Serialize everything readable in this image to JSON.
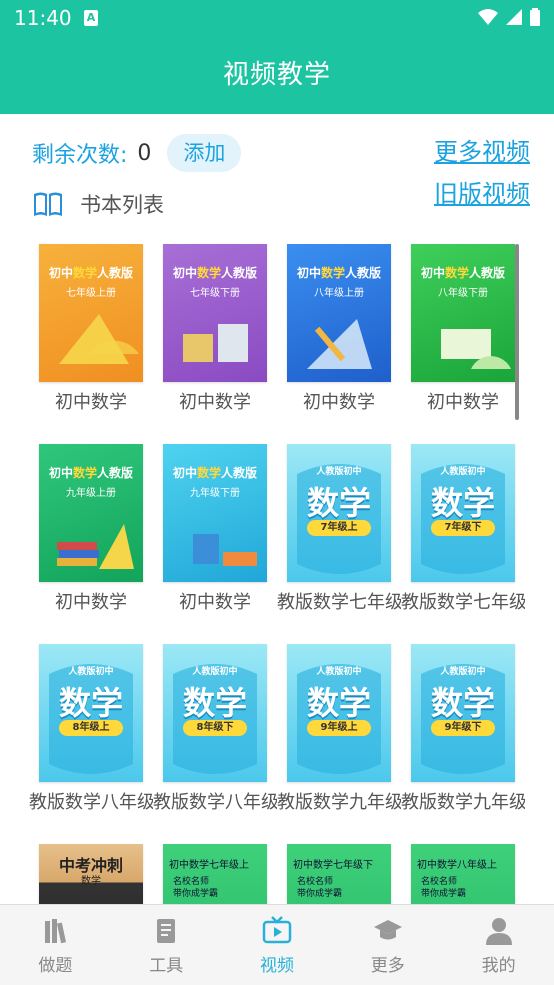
{
  "status_bar": {
    "time": "11:40",
    "notification": "A"
  },
  "header": {
    "title": "视频教学"
  },
  "remain": {
    "label": "剩余次数:",
    "count": "0",
    "add_label": "添加"
  },
  "links": {
    "more_videos": "更多视频",
    "old_videos": "旧版视频"
  },
  "book_list": {
    "title": "书本列表"
  },
  "books": [
    {
      "caption": "初中数学",
      "publisher": "人教版",
      "subject_prefix": "初中",
      "subject": "数学",
      "grade": "七年级上册",
      "style": "orange"
    },
    {
      "caption": "初中数学",
      "publisher": "人教版",
      "subject_prefix": "初中",
      "subject": "数学",
      "grade": "七年级下册",
      "style": "purple"
    },
    {
      "caption": "初中数学",
      "publisher": "人教版",
      "subject_prefix": "初中",
      "subject": "数学",
      "grade": "八年级上册",
      "style": "blue"
    },
    {
      "caption": "初中数学",
      "publisher": "人教版",
      "subject_prefix": "初中",
      "subject": "数学",
      "grade": "八年级下册",
      "style": "green"
    },
    {
      "caption": "初中数学",
      "publisher": "人教版",
      "subject_prefix": "初中",
      "subject": "数学",
      "grade": "九年级上册",
      "style": "green2"
    },
    {
      "caption": "初中数学",
      "publisher": "人教版",
      "subject_prefix": "初中",
      "subject": "数学",
      "grade": "九年级下册",
      "style": "cyan"
    },
    {
      "caption": "教版数学七年级",
      "header": "人教版初中",
      "big": "数学",
      "grade": "7年级上",
      "style": "splash"
    },
    {
      "caption": "教版数学七年级",
      "header": "人教版初中",
      "big": "数学",
      "grade": "7年级下",
      "style": "splash"
    },
    {
      "caption": "教版数学八年级",
      "header": "人教版初中",
      "big": "数学",
      "grade": "8年级上",
      "style": "splash"
    },
    {
      "caption": "教版数学八年级",
      "header": "人教版初中",
      "big": "数学",
      "grade": "8年级下",
      "style": "splash"
    },
    {
      "caption": "教版数学九年级",
      "header": "人教版初中",
      "big": "数学",
      "grade": "9年级上",
      "style": "splash"
    },
    {
      "caption": "教版数学九年级",
      "header": "人教版初中",
      "big": "数学",
      "grade": "9年级下",
      "style": "splash"
    },
    {
      "caption": "",
      "title": "中考冲刺",
      "subtitle": "数学",
      "style": "wood"
    },
    {
      "caption": "",
      "title": "初中数学七年级上",
      "line1": "名校名师",
      "line2": "带你成学霸",
      "style": "teacher"
    },
    {
      "caption": "",
      "title": "初中数学七年级下",
      "line1": "名校名师",
      "line2": "带你成学霸",
      "style": "teacher"
    },
    {
      "caption": "",
      "title": "初中数学八年级上",
      "line1": "名校名师",
      "line2": "带你成学霸",
      "style": "teacher"
    }
  ],
  "bottom_nav": [
    {
      "label": "做题",
      "icon": "books-icon",
      "active": false
    },
    {
      "label": "工具",
      "icon": "document-icon",
      "active": false
    },
    {
      "label": "视频",
      "icon": "tv-play-icon",
      "active": true
    },
    {
      "label": "更多",
      "icon": "graduation-cap-icon",
      "active": false
    },
    {
      "label": "我的",
      "icon": "person-icon",
      "active": false
    }
  ],
  "colors": {
    "accent": "#1dc4a2",
    "link": "#1aa3e0",
    "nav_active": "#2ab0d8"
  }
}
